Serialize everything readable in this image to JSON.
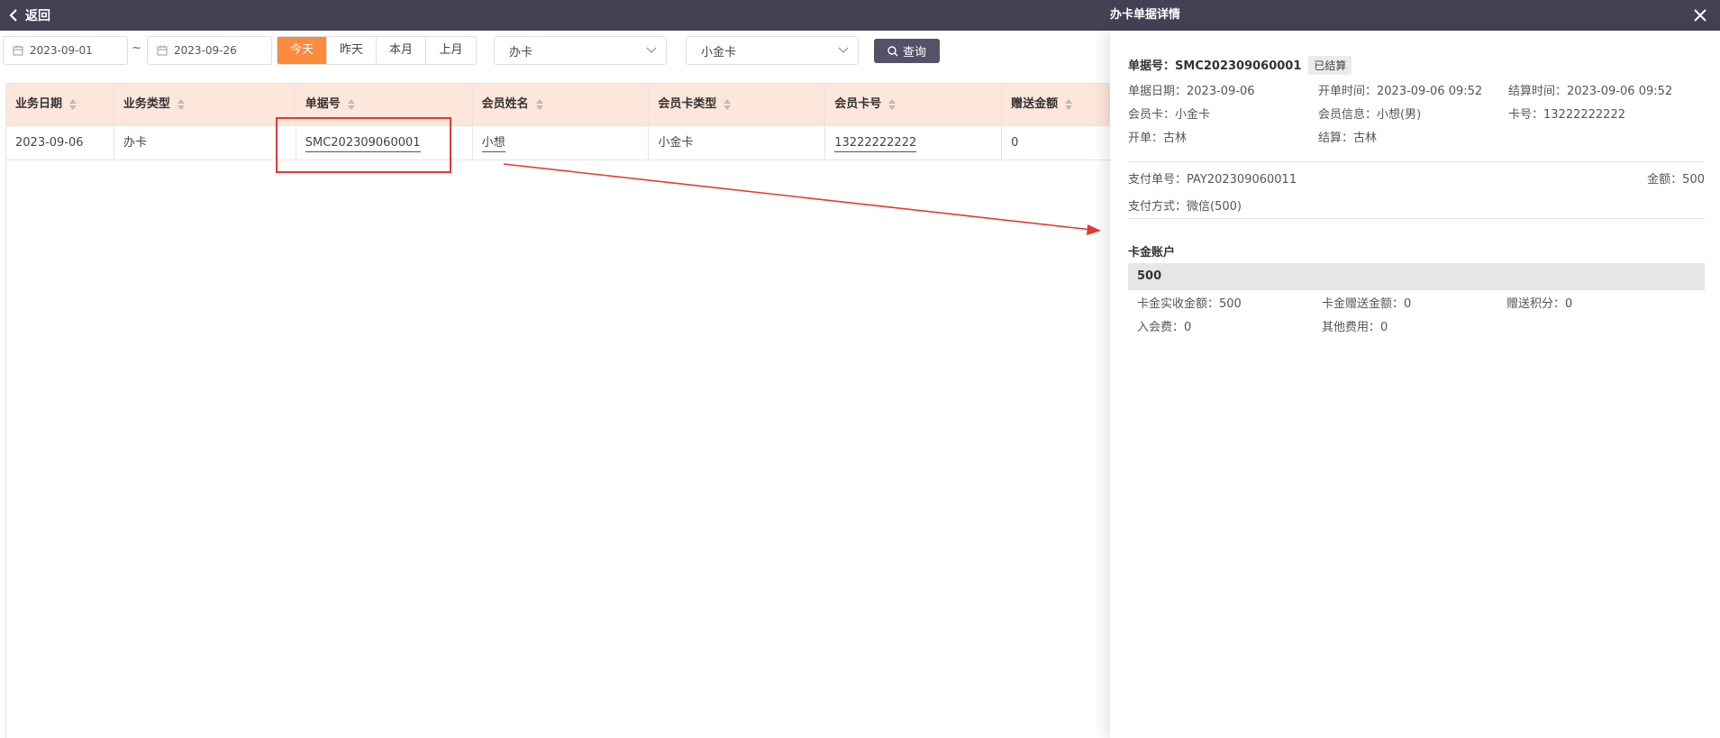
{
  "topbar": {
    "back_label": "返回",
    "drawer_title": "办卡单据详情"
  },
  "filters": {
    "date_start": "2023-09-01",
    "date_sep": "~",
    "date_end": "2023-09-26",
    "quick_ranges": [
      "今天",
      "昨天",
      "本月",
      "上月"
    ],
    "active_range": "今天",
    "business_type": "办卡",
    "card_type": "小金卡",
    "query_label": "查询"
  },
  "table": {
    "columns": [
      "业务日期",
      "业务类型",
      "单据号",
      "会员姓名",
      "会员卡类型",
      "会员卡号",
      "赠送金额"
    ],
    "rows": [
      [
        "2023-09-06",
        "办卡",
        "SMC202309060001",
        "小想",
        "小金卡",
        "13222222222",
        "0"
      ]
    ]
  },
  "detail": {
    "order_no_label": "单据号：",
    "order_no": "SMC202309060001",
    "status": "已结算",
    "date_label": "单据日期：",
    "date": "2023-09-06",
    "open_time_label": "开单时间：",
    "open_time": "2023-09-06 09:52",
    "settle_time_label": "结算时间：",
    "settle_time": "2023-09-06 09:52",
    "member_card_label": "会员卡：",
    "member_card": "小金卡",
    "member_info_label": "会员信息：",
    "member_info": "小想(男)",
    "card_no_label": "卡号：",
    "card_no": "13222222222",
    "opener_label": "开单：",
    "opener": "古林",
    "settler_label": "结算：",
    "settler": "古林",
    "pay_no_label": "支付单号：",
    "pay_no": "PAY202309060011",
    "amount_label": "金额：",
    "amount": "500",
    "pay_method_label": "支付方式：",
    "pay_method": "微信(500)",
    "account_section": "卡金账户",
    "account_total": "500",
    "received_label": "卡金实收金额：",
    "received": "500",
    "gift_label": "卡金赠送金额：",
    "gift": "0",
    "points_label": "赠送积分：",
    "points": "0",
    "fee_label": "入会费：",
    "fee": "0",
    "other_label": "其他费用：",
    "other": "0"
  }
}
